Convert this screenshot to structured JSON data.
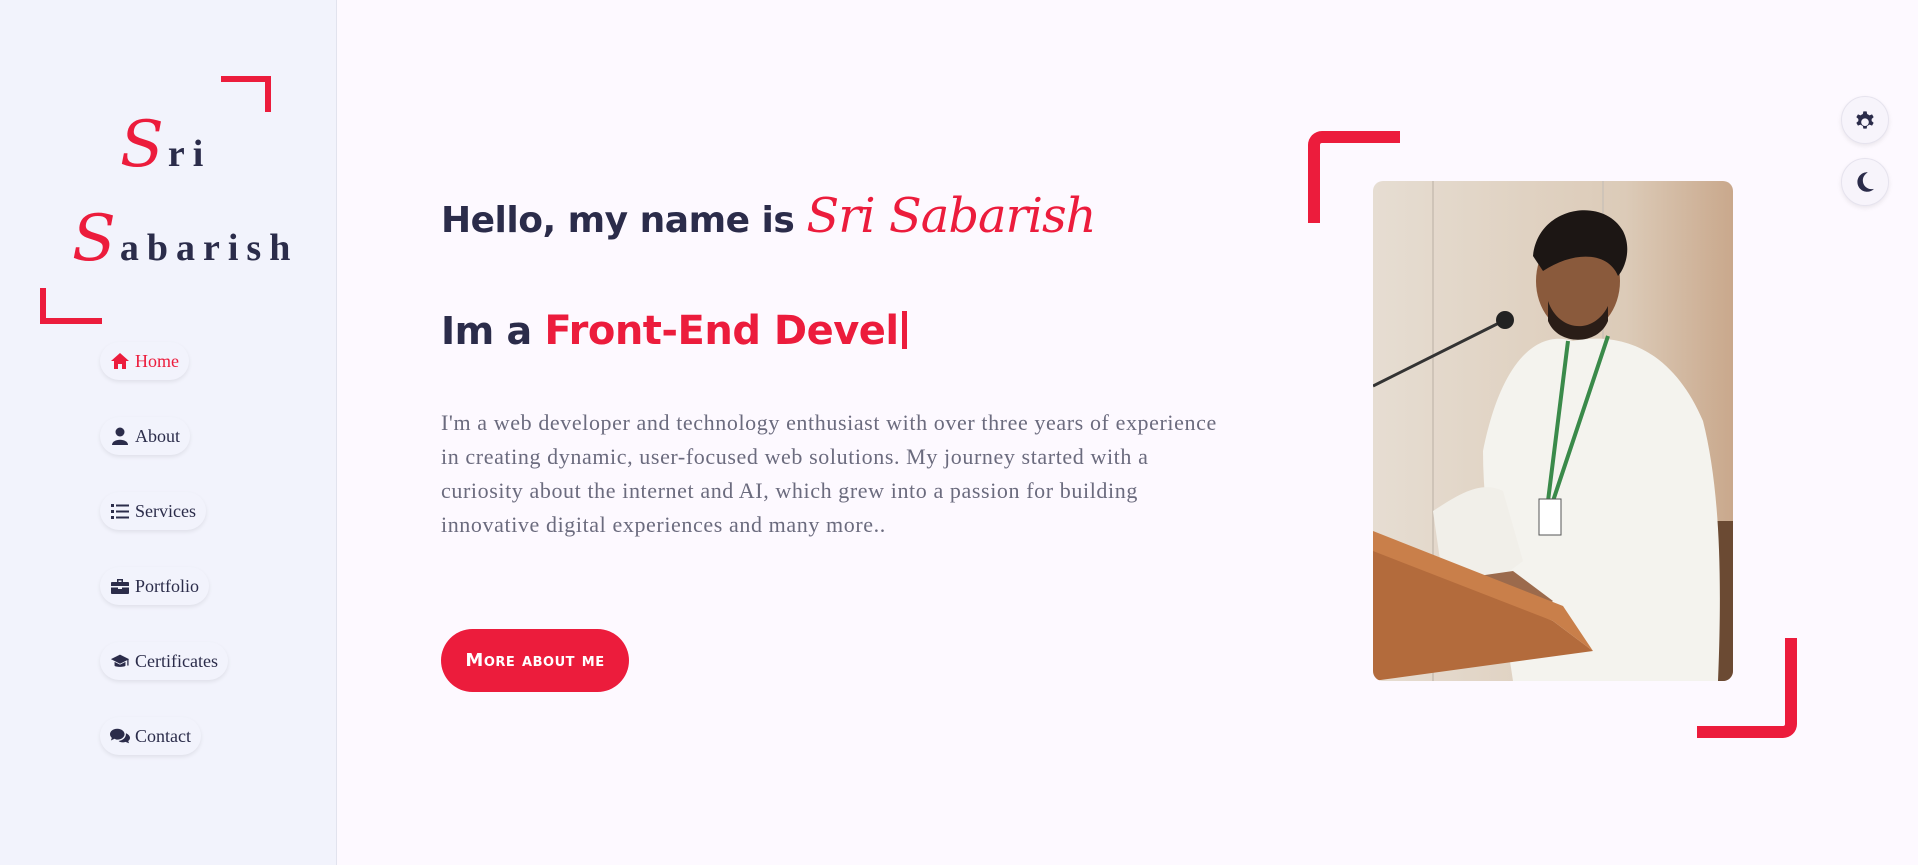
{
  "logo": {
    "line1_cap": "S",
    "line1_rest": "ri",
    "line2_cap": "S",
    "line2_rest": "abarish"
  },
  "nav": {
    "items": [
      {
        "label": "Home",
        "icon": "home-icon",
        "active": true
      },
      {
        "label": "About",
        "icon": "user-icon",
        "active": false
      },
      {
        "label": "Services",
        "icon": "list-icon",
        "active": false
      },
      {
        "label": "Portfolio",
        "icon": "briefcase-icon",
        "active": false
      },
      {
        "label": "Certificates",
        "icon": "graduation-cap-icon",
        "active": false
      },
      {
        "label": "Contact",
        "icon": "comments-icon",
        "active": false
      }
    ]
  },
  "hero": {
    "greeting": "Hello, my name is ",
    "name": "Sri Sabarish",
    "role_prefix": "Im a ",
    "role_typed": "Front-End Devel",
    "bio": "I'm a web developer and technology enthusiast with over three years of experience in creating dynamic, user-focused web solutions. My journey started with a curiosity about the internet and AI, which grew into a passion for building innovative digital experiences and many more..",
    "cta_label": "More about me"
  },
  "controls": {
    "settings_icon": "gear-icon",
    "theme_icon": "moon-icon"
  },
  "colors": {
    "accent": "#ec1c3c",
    "text": "#2b2c4a",
    "sidebar_bg": "#f2f3fc",
    "page_bg": "#fdf9ff"
  }
}
